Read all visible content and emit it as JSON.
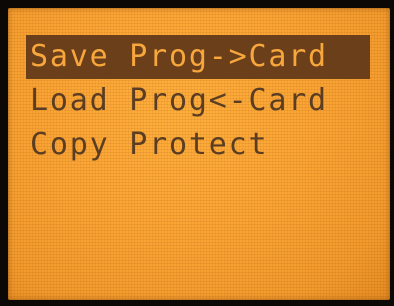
{
  "menu": {
    "items": [
      {
        "label": "Save Prog->Card",
        "selected": true
      },
      {
        "label": "Load Prog<-Card",
        "selected": false
      },
      {
        "label": "Copy Protect",
        "selected": false
      }
    ]
  },
  "colors": {
    "screen_background": "#fba434",
    "text": "#5a3d22",
    "highlight_background": "#6b3f1a",
    "highlight_text": "#f8a73d",
    "bezel": "#0c0805"
  }
}
